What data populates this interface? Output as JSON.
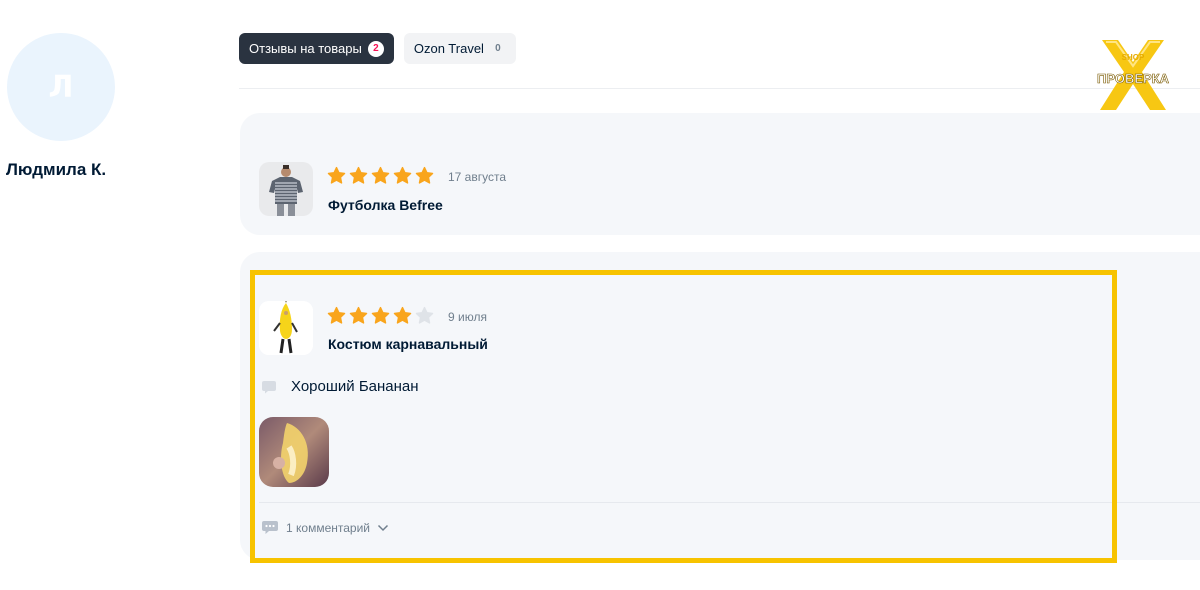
{
  "profile": {
    "avatar_letter": "Л",
    "name": "Людмила К."
  },
  "tabs": [
    {
      "label": "Отзывы на товары",
      "count": "2",
      "active": true
    },
    {
      "label": "Ozon Travel",
      "count": "0",
      "active": false
    }
  ],
  "reviews": [
    {
      "rating": 5,
      "max_rating": 5,
      "date": "17 августа",
      "product": "Футболка Befree"
    },
    {
      "rating": 4,
      "max_rating": 5,
      "date": "9 июля",
      "product": "Костюм карнавальный",
      "comment": "Хороший Бананан",
      "comments_label": "1 комментарий"
    }
  ],
  "colors": {
    "star_filled": "#f9a51c",
    "star_empty": "#dfe3e8",
    "highlight": "#f7c300",
    "tab_active_bg": "#2a3340",
    "badge_color": "#f91155"
  },
  "watermark": {
    "top_text": "SHOP",
    "main_text": "ПРОВЕРКА"
  }
}
